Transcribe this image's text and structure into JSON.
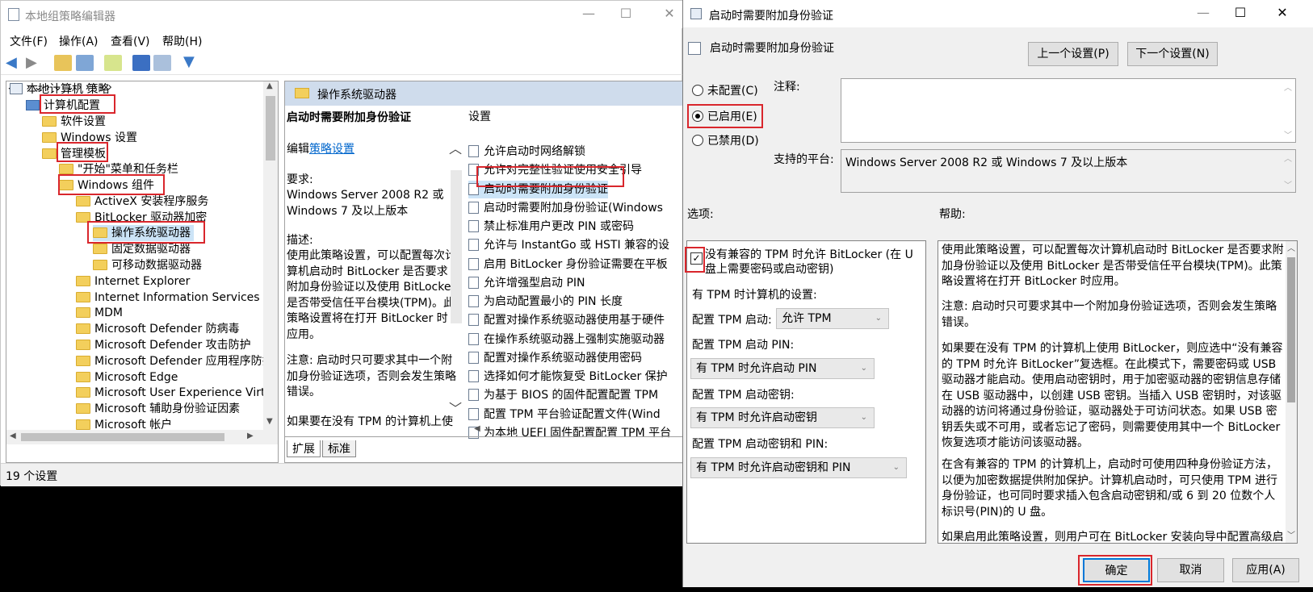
{
  "gpe": {
    "title": "本地组策略编辑器",
    "menu": [
      "文件(F)",
      "操作(A)",
      "查看(V)",
      "帮助(H)"
    ],
    "tree": {
      "root": "本地计算机 策略",
      "computer_config": "计算机配置",
      "software_settings": "软件设置",
      "windows_settings": "Windows 设置",
      "admin_templates": "管理模板",
      "start_menu": "\"开始\"菜单和任务栏",
      "windows_components": "Windows 组件",
      "activex": "ActiveX 安装程序服务",
      "bitlocker": "BitLocker 驱动器加密",
      "os_drives": "操作系统驱动器",
      "fixed_drives": "固定数据驱动器",
      "removable_drives": "可移动数据驱动器",
      "ie": "Internet Explorer",
      "iis": "Internet Information Services",
      "mdm": "MDM",
      "defender_av": "Microsoft Defender 防病毒",
      "defender_exploit": "Microsoft Defender 攻击防护",
      "defender_app": "Microsoft Defender 应用程序防护",
      "edge": "Microsoft Edge",
      "uev": "Microsoft User Experience Virtual",
      "aux_auth": "Microsoft 辅助身份验证因素",
      "account": "Microsoft 帐户"
    },
    "right_header": "操作系统驱动器",
    "description": {
      "title": "启动时需要附加身份验证",
      "edit_prefix": "编辑",
      "edit_link": "策略设置",
      "requirements_label": "要求:",
      "requirements": "Windows Server 2008 R2 或 Windows 7 及以上版本",
      "desc_label": "描述:",
      "desc": "使用此策略设置，可以配置每次计算机启动时 BitLocker 是否要求附加身份验证以及使用 BitLocker 是否带受信任平台模块(TPM)。此策略设置将在打开 BitLocker 时应用。",
      "note": "注意: 启动时只可要求其中一个附加身份验证选项，否则会发生策略错误。",
      "more": "如果要在没有 TPM 的计算机上使"
    },
    "settings_header": "设置",
    "settings": [
      "允许启动时网络解锁",
      "允许对完整性验证使用安全引导",
      "启动时需要附加身份验证",
      "启动时需要附加身份验证(Windows",
      "禁止标准用户更改 PIN 或密码",
      "允许与 InstantGo 或 HSTI 兼容的设",
      "启用 BitLocker 身份验证需要在平板",
      "允许增强型启动 PIN",
      "为启动配置最小的 PIN 长度",
      "配置对操作系统驱动器使用基于硬件",
      "在操作系统驱动器上强制实施驱动器",
      "配置对操作系统驱动器使用密码",
      "选择如何才能恢复受 BitLocker 保护",
      "为基于 BIOS 的固件配置配置 TPM",
      "配置 TPM 平台验证配置文件(Wind",
      "为本地 UEFI 固件配置配置 TPM 平台"
    ],
    "tabs": [
      "扩展",
      "标准"
    ],
    "status": "19 个设置"
  },
  "dialog": {
    "title": "启动时需要附加身份验证",
    "policy_name": "启动时需要附加身份验证",
    "prev_button": "上一个设置(P)",
    "next_button": "下一个设置(N)",
    "radio_not_configured": "未配置(C)",
    "radio_enabled": "已启用(E)",
    "radio_disabled": "已禁用(D)",
    "comment_label": "注释:",
    "platform_label": "支持的平台:",
    "platform_value": "Windows Server 2008 R2 或 Windows 7 及以上版本",
    "options_label": "选项:",
    "help_label": "帮助:",
    "options": {
      "checkbox_line1": "没有兼容的 TPM 时允许 BitLocker (在 U",
      "checkbox_line2": "盘上需要密码或启动密钥)",
      "with_tpm_label": "有 TPM 时计算机的设置:",
      "tpm_startup_label": "配置 TPM 启动:",
      "tpm_startup_value": "允许 TPM",
      "tpm_pin_label": "配置 TPM 启动 PIN:",
      "tpm_pin_value": "有 TPM 时允许启动 PIN",
      "tpm_key_label": "配置 TPM 启动密钥:",
      "tpm_key_value": "有 TPM 时允许启动密钥",
      "tpm_key_pin_label": "配置 TPM 启动密钥和 PIN:",
      "tpm_key_pin_value": "有 TPM 时允许启动密钥和 PIN"
    },
    "help": {
      "p1": "使用此策略设置，可以配置每次计算机启动时 BitLocker 是否要求附加身份验证以及使用 BitLocker 是否带受信任平台模块(TPM)。此策略设置将在打开 BitLocker 时应用。",
      "p2": "注意: 启动时只可要求其中一个附加身份验证选项，否则会发生策略错误。",
      "p3": "如果要在没有 TPM 的计算机上使用 BitLocker，则应选中“没有兼容的 TPM 时允许 BitLocker”复选框。在此模式下，需要密码或 USB 驱动器才能启动。使用启动密钥时，用于加密驱动器的密钥信息存储在 USB 驱动器中，以创建 USB 密钥。当插入 USB 密钥时，对该驱动器的访问将通过身份验证，驱动器处于可访问状态。如果 USB 密钥丢失或不可用，或者忘记了密码，则需要使用其中一个 BitLocker 恢复选项才能访问该驱动器。",
      "p4": "在含有兼容的 TPM 的计算机上，启动时可使用四种身份验证方法，以便为加密数据提供附加保护。计算机启动时，可只使用 TPM 进行身份验证，也可同时要求插入包含启动密钥和/或 6 到 20 位数个人标识号(PIN)的 U 盘。",
      "p5": "如果启用此策略设置，则用户可在 BitLocker 安装向导中配置高级启动选"
    },
    "ok_button": "确定",
    "cancel_button": "取消",
    "apply_button": "应用(A)"
  }
}
